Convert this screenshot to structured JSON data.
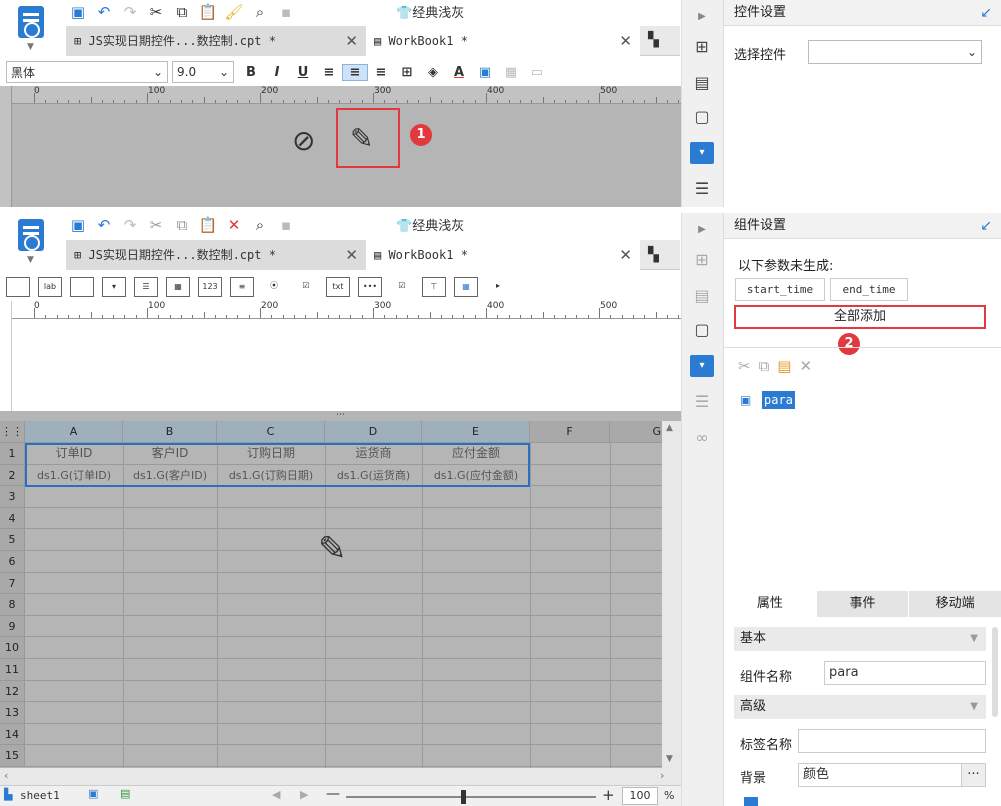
{
  "top": {
    "tabs": [
      {
        "label": "JS实现日期控件...数控制.cpt *"
      },
      {
        "label": "WorkBook1 *"
      }
    ],
    "theme_label": "经典浅灰",
    "font": "黑体",
    "size": "9.0",
    "ruler_labels": [
      "0",
      "100",
      "200",
      "300",
      "400",
      "500"
    ],
    "right_panel_title": "控件设置",
    "choose_widget_label": "选择控件",
    "choose_widget_value": ""
  },
  "bottom": {
    "tabs": [
      {
        "label": "JS实现日期控件...数控制.cpt *"
      },
      {
        "label": "WorkBook1 *"
      }
    ],
    "theme_label": "经典浅灰",
    "ruler_labels": [
      "0",
      "100",
      "200",
      "300",
      "400",
      "500"
    ],
    "right_panel_title": "组件设置",
    "params_note": "以下参数未生成:",
    "params": [
      "start_time",
      "end_time"
    ],
    "add_all": "全部添加",
    "tree_item": "para",
    "prop_tabs": [
      "属性",
      "事件",
      "移动端"
    ],
    "section_basic": "基本",
    "widget_name_label": "组件名称",
    "widget_name_value": "para",
    "section_advanced": "高级",
    "tag_name_label": "标签名称",
    "tag_name_value": "",
    "background_label": "背景",
    "background_value": "颜色",
    "sheet_name": "sheet1",
    "zoom": "100",
    "zoom_suffix": "%",
    "columns": [
      "A",
      "B",
      "C",
      "D",
      "E",
      "F",
      "G"
    ],
    "rows": [
      "1",
      "2",
      "3",
      "4",
      "5",
      "6",
      "7",
      "8",
      "9",
      "10",
      "11",
      "12",
      "13",
      "14",
      "15"
    ],
    "header_row": [
      "订单ID",
      "客户ID",
      "订购日期",
      "运货商",
      "应付金额"
    ],
    "data_row": [
      "ds1.G(订单ID)",
      "ds1.G(客户ID)",
      "ds1.G(订购日期)",
      "ds1.G(运货商)",
      "ds1.G(应付金额)"
    ]
  },
  "badges": [
    "1",
    "2"
  ],
  "colors": {
    "accent": "#2a7bd1",
    "highlight": "#e0393e",
    "design_gray": "#b5b5b5"
  }
}
